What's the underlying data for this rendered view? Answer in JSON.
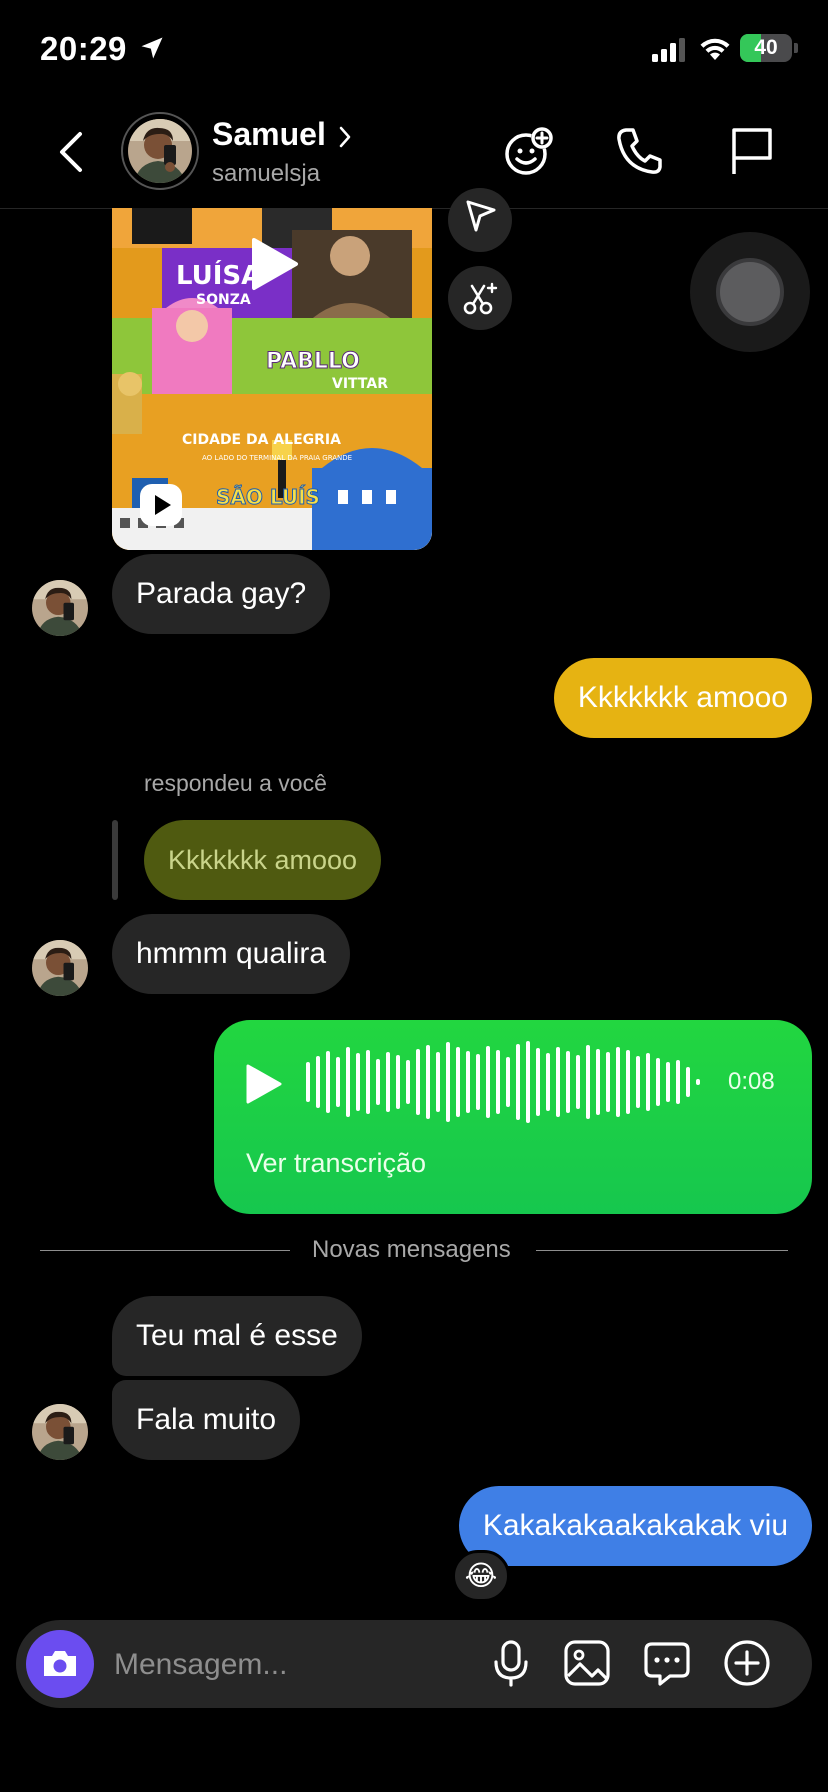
{
  "status_bar": {
    "time": "20:29",
    "battery": "40",
    "battery_level": 0.4
  },
  "header": {
    "name": "Samuel",
    "username": "samuelsja"
  },
  "media_poster": {
    "line1": "LUÍSA",
    "line2": "SONZA",
    "line3": "PABLLO",
    "line4": "VITTAR",
    "place": "CIDADE DA ALEGRIA",
    "place_sub": "AO LADO DO TERMINAL DA PRAIA GRANDE",
    "city": "SÃO LUÍS"
  },
  "messages": {
    "m1": "Parada gay?",
    "m2": "Kkkkkkk amooo",
    "reply_label": "respondeu a você",
    "reply_quote": "Kkkkkkk amooo",
    "m3": "hmmm qualira",
    "voice_duration": "0:08",
    "voice_transcript": "Ver transcrição",
    "divider": "Novas mensagens",
    "m4": "Teu mal é esse",
    "m5": "Fala muito",
    "m6": "Kakakakaakakakak viu",
    "m6_reaction": "😂"
  },
  "composer": {
    "placeholder": "Mensagem..."
  },
  "colors": {
    "sent_yellow": "#e6b312",
    "sent_green": "#1ed14a",
    "sent_blue": "#3f7fe6",
    "received": "#262626",
    "camera_button": "#6b4df0"
  }
}
